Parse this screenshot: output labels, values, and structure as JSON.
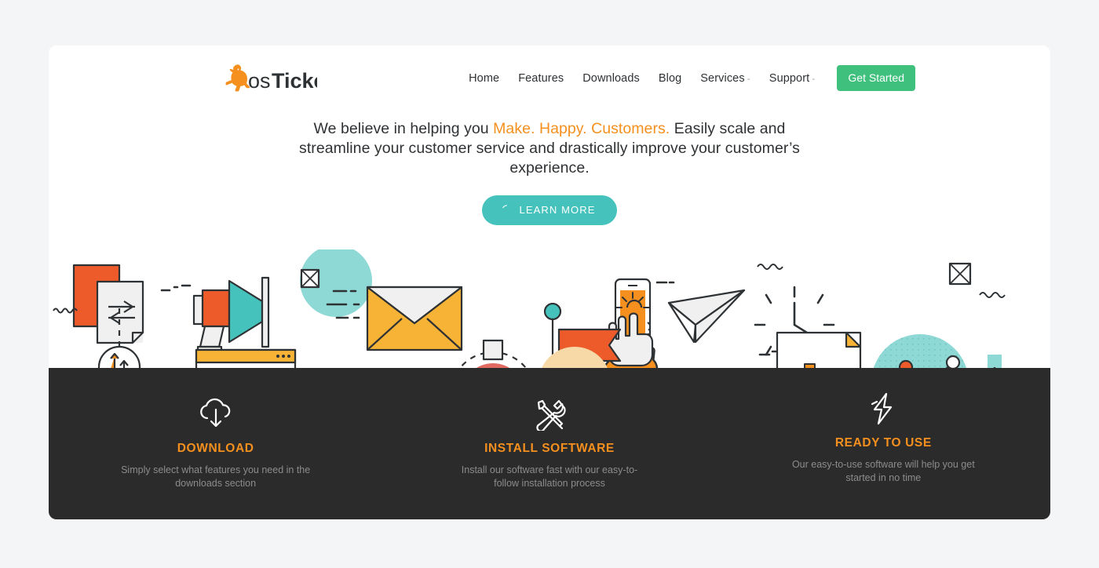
{
  "brand": {
    "name": "osTicket",
    "name_light": "os",
    "name_bold": "Ticket",
    "logo_icon": "kangaroo-icon",
    "logo_color": "#f5901e"
  },
  "colors": {
    "page_background": "#f4f5f7",
    "card_background": "#ffffff",
    "accent_orange": "#f5901e",
    "accent_teal": "#46c2bd",
    "accent_green": "#3fc07c",
    "dark_section": "#2b2b2b",
    "illustration_red": "#ed5b2a",
    "illustration_yellow": "#f6b335",
    "illustration_light_teal": "#8ed8d5",
    "illustration_sand": "#f6d9a6",
    "illustration_rose": "#e06a62"
  },
  "nav": {
    "items": [
      {
        "label": "Home",
        "has_caret": false
      },
      {
        "label": "Features",
        "has_caret": false
      },
      {
        "label": "Downloads",
        "has_caret": false
      },
      {
        "label": "Blog",
        "has_caret": false
      },
      {
        "label": "Services",
        "has_caret": true,
        "caret": "-"
      },
      {
        "label": "Support",
        "has_caret": true,
        "caret": "-"
      }
    ],
    "cta_label": "Get Started"
  },
  "hero": {
    "lead": "We believe in helping you ",
    "highlight": "Make. Happy. Customers.",
    "tail": " Easily scale and streamline your customer service and drastically improve your customer’s experience.",
    "button_label": "LEARN MORE",
    "button_icon": "spinner-arc-icon"
  },
  "features": [
    {
      "icon": "cloud-download-icon",
      "title": "DOWNLOAD",
      "description": "Simply select what features you need in the downloads section"
    },
    {
      "icon": "wrench-screwdriver-icon",
      "title": "INSTALL SOFTWARE",
      "description": "Install our software fast with our easy-to-follow installation process"
    },
    {
      "icon": "lightning-bolt-icon",
      "title": "READY TO USE",
      "description": "Our easy-to-use software will help you get started in no time"
    }
  ],
  "illustration": {
    "name": "customer-service-flat-illustration",
    "elements": [
      "document-exchange-icon",
      "megaphone-icon",
      "envelope-icon",
      "browser-window-icon",
      "up-down-arrows-icon",
      "avatar-network-icon",
      "kangaroo-icon",
      "smartphone-tap-icon",
      "paper-plane-icon",
      "clock-icon",
      "open-envelope-letter-icon",
      "flag-icon",
      "bar-chart-document-icon",
      "line-graph-icon",
      "gear-icon"
    ]
  }
}
